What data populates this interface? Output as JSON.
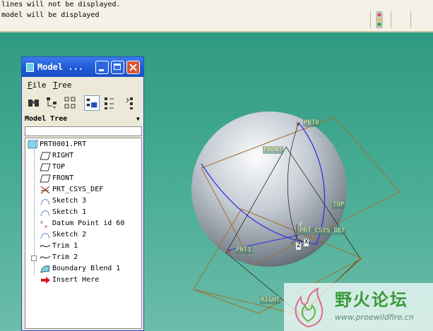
{
  "message_area": {
    "lines": [
      "lines will not be displayed.",
      "model will be displayed"
    ]
  },
  "model_tree": {
    "window_title": "Model ...",
    "menu": [
      "File",
      "Tree"
    ],
    "label": "Model Tree",
    "items": [
      {
        "label": "PRT0001.PRT",
        "icon": "part-icon"
      },
      {
        "label": "RIGHT",
        "icon": "datum-plane-icon"
      },
      {
        "label": "TOP",
        "icon": "datum-plane-icon"
      },
      {
        "label": "FRONT",
        "icon": "datum-plane-icon"
      },
      {
        "label": "PRT_CSYS_DEF",
        "icon": "csys-icon"
      },
      {
        "label": "Sketch 3",
        "icon": "sketch-icon"
      },
      {
        "label": "Sketch 1",
        "icon": "sketch-icon"
      },
      {
        "label": "Datum Point id 60",
        "icon": "datum-point-icon"
      },
      {
        "label": "Sketch 2",
        "icon": "sketch-icon"
      },
      {
        "label": "Trim 1",
        "icon": "curve-icon"
      },
      {
        "label": "Trim 2",
        "icon": "curve-icon"
      },
      {
        "label": "Boundary Blend 1",
        "icon": "boundary-blend-icon"
      },
      {
        "label": "Insert Here",
        "icon": "insert-arrow-icon"
      }
    ]
  },
  "viewport": {
    "labels": {
      "pnt0": "PNT0",
      "front": "FRONT",
      "top": "TOP",
      "csys": "PRT_CSYS_DEF",
      "pnt1": "PNT1",
      "right": "RIGHT",
      "axis_x": "X",
      "axis_y": "Y",
      "axis_z": "Z"
    }
  },
  "watermark": {
    "title": "野火论坛",
    "url": "www.proewildfire.cn"
  },
  "colors": {
    "viewport_top": "#2f9a82",
    "viewport_bottom": "#6cbdaa",
    "datum": "#b07a2a",
    "curve": "#2a2ae0",
    "titlebar": "#1f5ad6"
  }
}
